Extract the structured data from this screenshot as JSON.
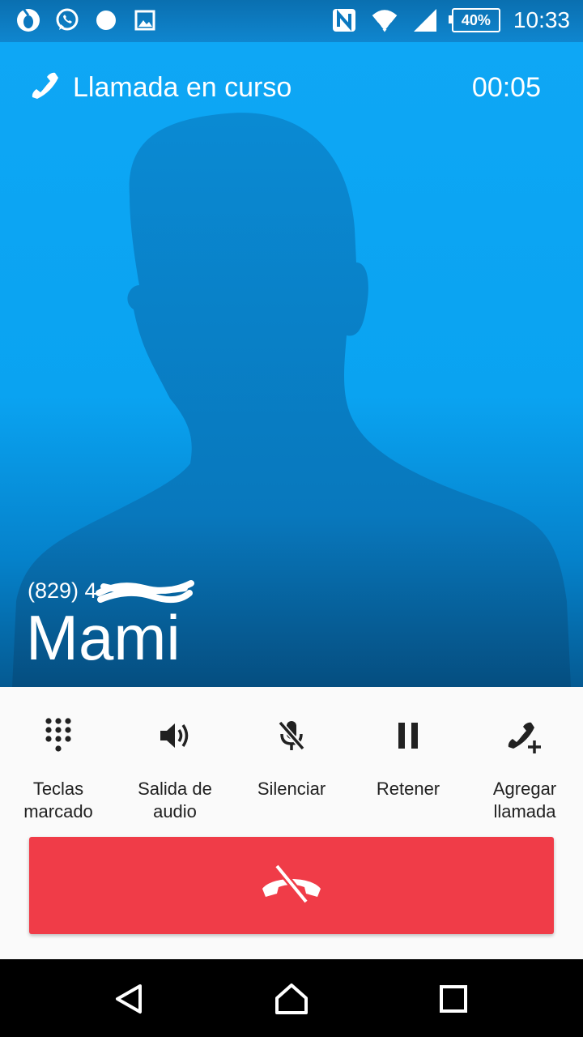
{
  "status_bar": {
    "icons_left": [
      "opera-icon",
      "whatsapp-icon",
      "notification-dot-icon",
      "image-icon"
    ],
    "icons_right": [
      "nfc-icon",
      "wifi-icon",
      "signal-icon"
    ],
    "battery": "40%",
    "time": "10:33"
  },
  "call": {
    "status_label": "Llamada en curso",
    "timer": "00:05",
    "number_visible": "(829) 4",
    "contact_name": "Mami"
  },
  "controls": [
    {
      "id": "dialpad",
      "label": "Teclas\nmarcado",
      "icon": "dialpad-icon"
    },
    {
      "id": "audio",
      "label": "Salida de\naudio",
      "icon": "speaker-icon"
    },
    {
      "id": "mute",
      "label": "Silenciar",
      "icon": "mic-off-icon"
    },
    {
      "id": "hold",
      "label": "Retener",
      "icon": "pause-icon"
    },
    {
      "id": "add",
      "label": "Agregar\nllamada",
      "icon": "add-call-icon"
    }
  ],
  "colors": {
    "hero_blue": "#0ea7f5",
    "end_call_red": "#f03c48",
    "controls_bg": "#fafafa"
  },
  "nav_bar": [
    "back-icon",
    "home-icon",
    "recents-icon"
  ]
}
